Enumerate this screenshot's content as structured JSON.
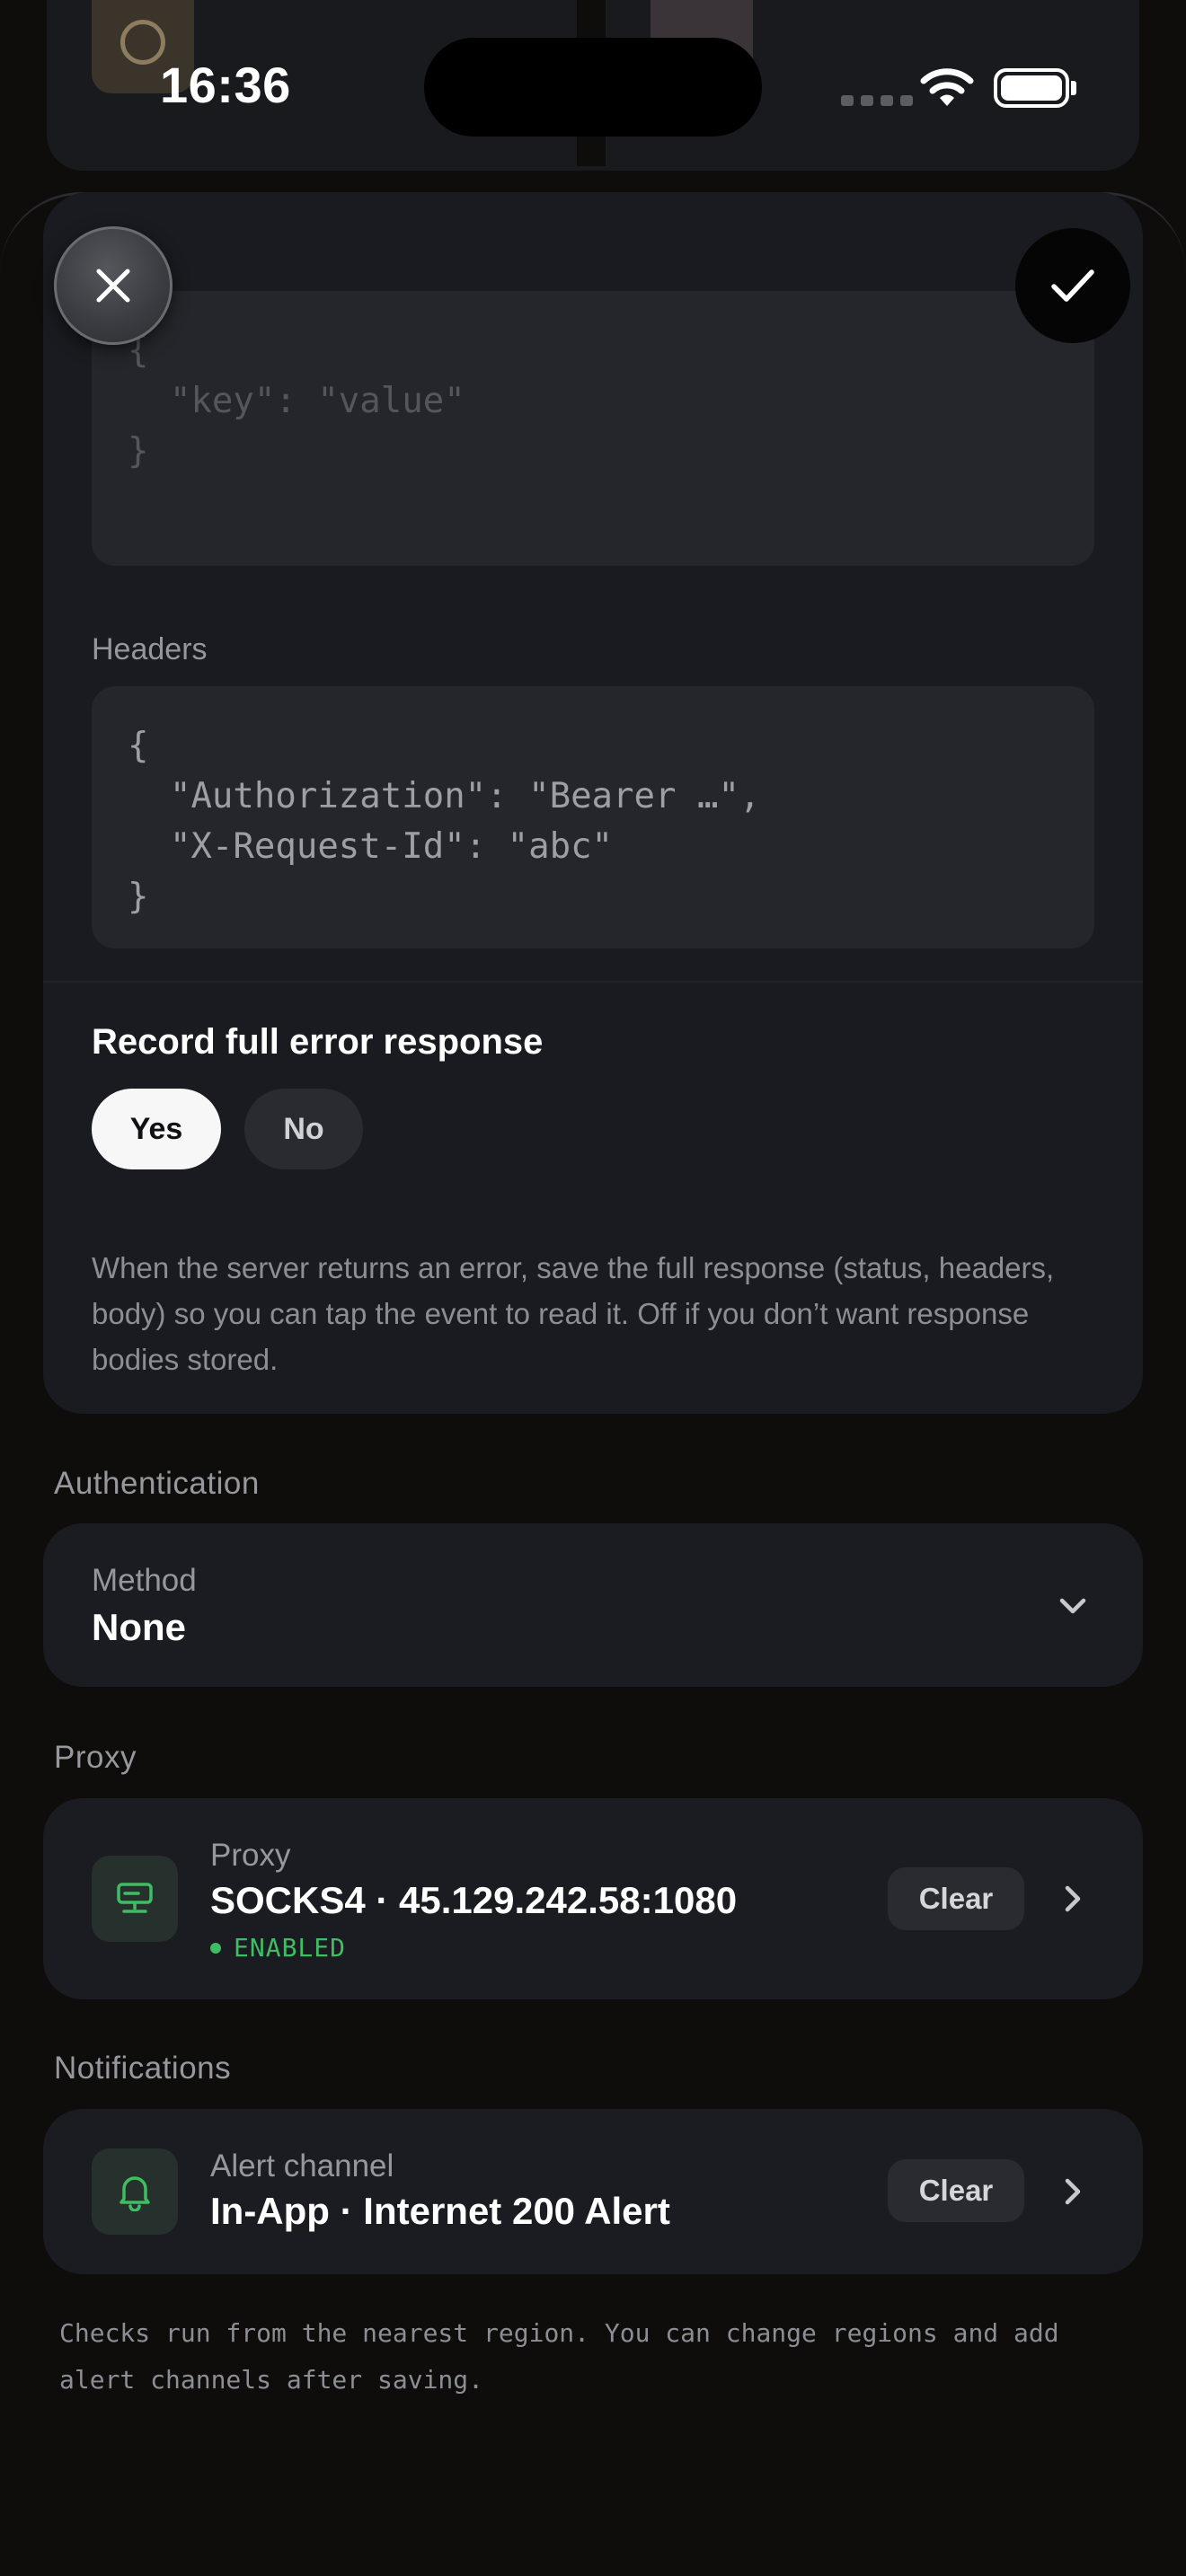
{
  "status_bar": {
    "time": "16:36"
  },
  "body_editor": {
    "lines": [
      "{",
      "  \"key\": \"value\"",
      "}"
    ]
  },
  "headers": {
    "label": "Headers",
    "lines": [
      "{",
      "  \"Authorization\": \"Bearer …\",",
      "  \"X-Request-Id\": \"abc\"",
      "}"
    ]
  },
  "record_error": {
    "title": "Record full error response",
    "options": [
      "Yes",
      "No"
    ],
    "selected": "Yes",
    "help": "When the server returns an error, save the full response (status, headers, body) so you can tap the event to read it. Off if you don’t want response bodies stored."
  },
  "authentication": {
    "header": "Authentication",
    "method_label": "Method",
    "method_value": "None"
  },
  "proxy": {
    "header": "Proxy",
    "label": "Proxy",
    "value": "SOCKS4 · 45.129.242.58:1080",
    "status": "ENABLED",
    "clear_label": "Clear",
    "icon": "server-icon"
  },
  "notifications": {
    "header": "Notifications",
    "label": "Alert channel",
    "value": "In-App · Internet 200 Alert",
    "clear_label": "Clear",
    "icon": "bell-icon"
  },
  "footer": "Checks run from the nearest region. You can change regions and add alert channels after saving.",
  "colors": {
    "background": "#0e0d0b",
    "card": "#1b1c21",
    "accent_green": "#3fbd63",
    "selected_pill": "#f7f7f8"
  }
}
